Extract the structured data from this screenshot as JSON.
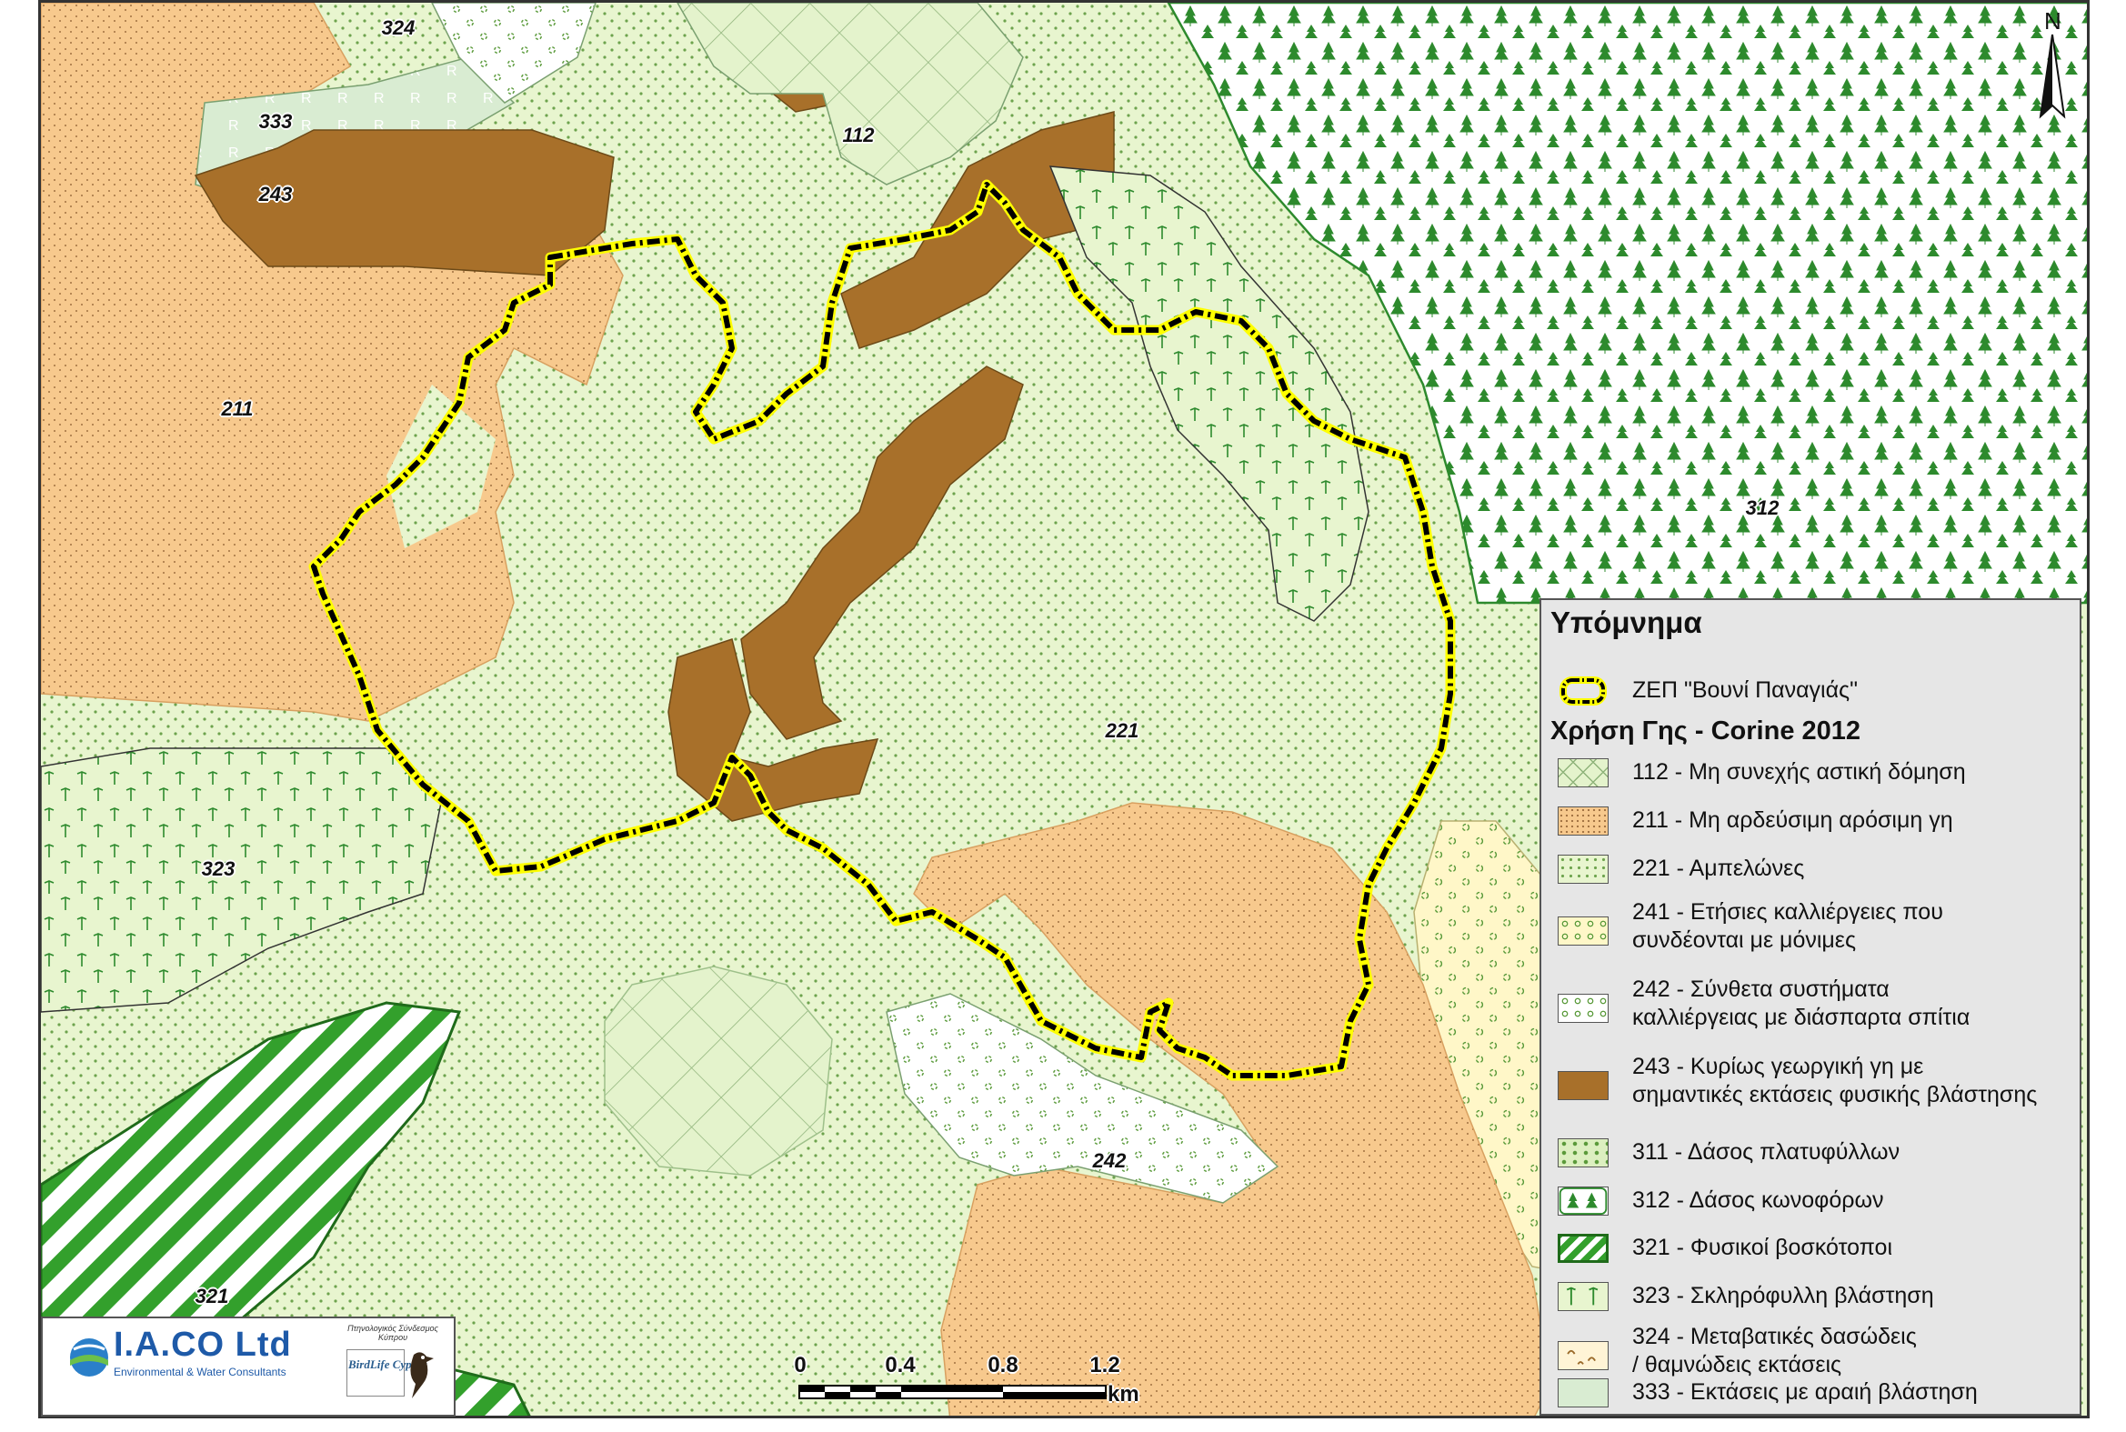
{
  "map": {
    "zone_labels": [
      {
        "id": "z324",
        "text": "324"
      },
      {
        "id": "z333",
        "text": "333"
      },
      {
        "id": "z243",
        "text": "243"
      },
      {
        "id": "z112",
        "text": "112"
      },
      {
        "id": "z211",
        "text": "211"
      },
      {
        "id": "z312",
        "text": "312"
      },
      {
        "id": "z221",
        "text": "221"
      },
      {
        "id": "z323",
        "text": "323"
      },
      {
        "id": "z242",
        "text": "242"
      },
      {
        "id": "z321",
        "text": "321"
      }
    ],
    "north_label": "N",
    "colors": {
      "arable_211": "#f7c98d",
      "vineyard_221": "#e8f5cf",
      "agri_natural_243": "#a8702a",
      "urban_112": "#e4f3cc",
      "forest_312": "#ffffff",
      "boundary_yellow": "#ffff00",
      "boundary_black": "#000000",
      "grassland_321": "#33a02c",
      "sparse_333": "#d9ecd2"
    }
  },
  "legend": {
    "title": "Υπόμνημα",
    "boundary_label": "ΖΕΠ \"Βουνί Παναγιάς\"",
    "subtitle": "Χρήση Γης - Corine 2012",
    "items": [
      {
        "code": "112",
        "label": "112 - Μη συνεχής αστική δόμηση",
        "icon": "urban-swatch"
      },
      {
        "code": "211",
        "label": "211 - Μη αρδεύσιμη αρόσιμη γη",
        "icon": "arable-swatch"
      },
      {
        "code": "221",
        "label": "221 - Αμπελώνες",
        "icon": "vineyard-swatch"
      },
      {
        "code": "241",
        "label": "241 - Ετήσιες καλλιέργειες που\nσυνδέονται με μόνιμες",
        "icon": "annual-crops-swatch"
      },
      {
        "code": "242",
        "label": "242 - Σύνθετα συστήματα\nκαλλιέργειας με διάσπαρτα σπίτια",
        "icon": "complex-cultivation-swatch"
      },
      {
        "code": "243",
        "label": "243 - Κυρίως γεωργική γη με\nσημαντικές εκτάσεις φυσικής βλάστησης",
        "icon": "agri-natural-swatch"
      },
      {
        "code": "311",
        "label": "311 - Δάσος πλατυφύλλων",
        "icon": "broadleaf-forest-swatch"
      },
      {
        "code": "312",
        "label": "312 - Δάσος κωνοφόρων",
        "icon": "coniferous-forest-swatch"
      },
      {
        "code": "321",
        "label": "321 - Φυσικοί βοσκότοποι",
        "icon": "grassland-swatch"
      },
      {
        "code": "323",
        "label": "323 - Σκληρόφυλλη βλάστηση",
        "icon": "sclerophyllous-swatch"
      },
      {
        "code": "324",
        "label": "324 - Μεταβατικές δασώδεις\n/ θαμνώδεις εκτάσεις",
        "icon": "woodland-shrub-swatch"
      },
      {
        "code": "333",
        "label": "333 - Εκτάσεις με αραιή βλάστηση",
        "icon": "sparse-vegetation-swatch"
      }
    ]
  },
  "scalebar": {
    "ticks": [
      "0",
      "0.4",
      "0.8",
      "1.2"
    ],
    "unit": "km"
  },
  "logos": {
    "iaco_name": "I.A.CO Ltd",
    "iaco_subtitle": "Environmental & Water Consultants",
    "birdlife_tagline": "Πτηνολογικός Σύνδεσμος Κύπρου",
    "birdlife_name": "BirdLife Cyprus"
  }
}
